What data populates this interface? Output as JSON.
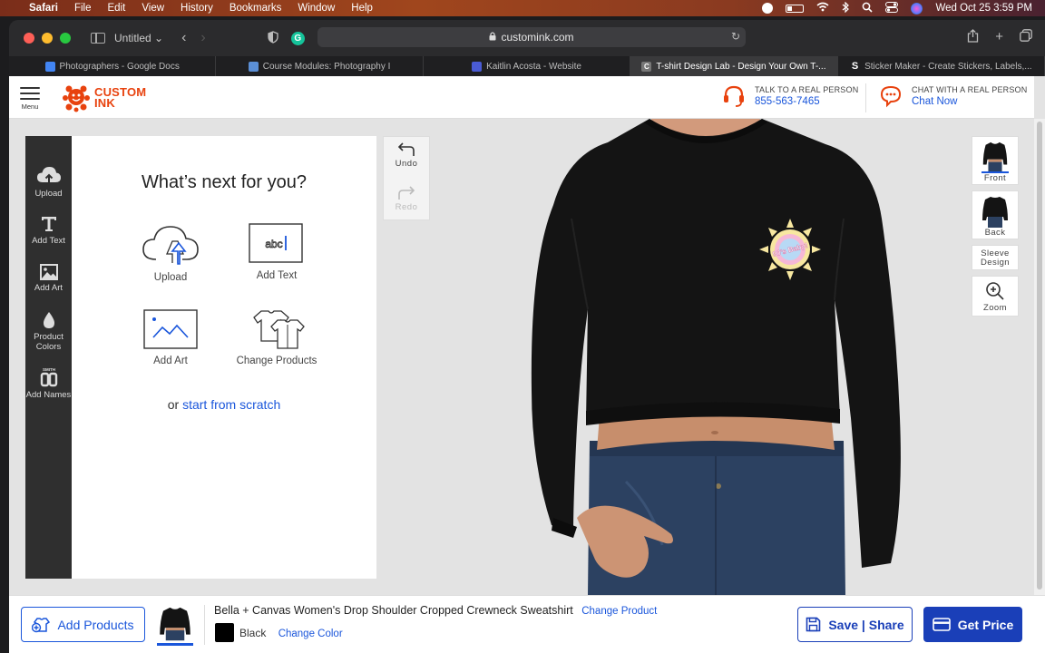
{
  "menubar": {
    "app": "Safari",
    "items": [
      "File",
      "Edit",
      "View",
      "History",
      "Bookmarks",
      "Window",
      "Help"
    ],
    "datetime": "Wed Oct 25  3:59 PM"
  },
  "browser": {
    "tab_group": "Untitled",
    "url": "customink.com",
    "tabs": [
      {
        "title": "Photographers - Google Docs",
        "color": "#4285f4"
      },
      {
        "title": "Course Modules: Photography I",
        "color": "#5b8fd6"
      },
      {
        "title": "Kaitlin Acosta - Website",
        "color": "#4a5bd4"
      },
      {
        "title": "T-shirt Design Lab - Design Your Own T-...",
        "color": "#777777",
        "active": true
      },
      {
        "title": "Sticker Maker - Create Stickers, Labels,...",
        "color": "#222222"
      }
    ]
  },
  "header": {
    "menu_label": "Menu",
    "logo_line1": "CUSTOM",
    "logo_line2": "INK",
    "talk_label": "TALK TO A REAL PERSON",
    "phone": "855-563-7465",
    "chat_label": "CHAT WITH A REAL PERSON",
    "chat_link": "Chat Now"
  },
  "tools": [
    {
      "label": "Upload",
      "icon": "cloud-upload-icon"
    },
    {
      "label": "Add Text",
      "icon": "text-icon"
    },
    {
      "label": "Add Art",
      "icon": "image-icon"
    },
    {
      "label": "Product Colors",
      "icon": "droplet-icon"
    },
    {
      "label": "Add Names",
      "icon": "jersey-number-icon"
    }
  ],
  "tool_name_badge": "SMITH",
  "panel": {
    "title": "What’s next for you?",
    "choices": [
      {
        "label": "Upload"
      },
      {
        "label": "Add Text",
        "sample": "abc"
      },
      {
        "label": "Add Art"
      },
      {
        "label": "Change Products"
      }
    ],
    "scratch_prefix": "or",
    "scratch_link": "start from scratch"
  },
  "history": {
    "undo": "Undo",
    "redo": "Redo"
  },
  "design": {
    "text": "90's Baby!"
  },
  "views": {
    "front": "Front",
    "back": "Back",
    "sleeve": "Sleeve Design",
    "zoom": "Zoom"
  },
  "footer": {
    "add_products": "Add Products",
    "product_name": "Bella + Canvas Women's Drop Shoulder Cropped Crewneck Sweatshirt",
    "change_product": "Change Product",
    "color_name": "Black",
    "change_color": "Change Color",
    "save_share": "Save | Share",
    "get_price": "Get Price"
  },
  "colors": {
    "brand_orange": "#e8420e",
    "link_blue": "#1a56db",
    "cta_blue": "#1a3fb8",
    "product_color": "#000000"
  }
}
